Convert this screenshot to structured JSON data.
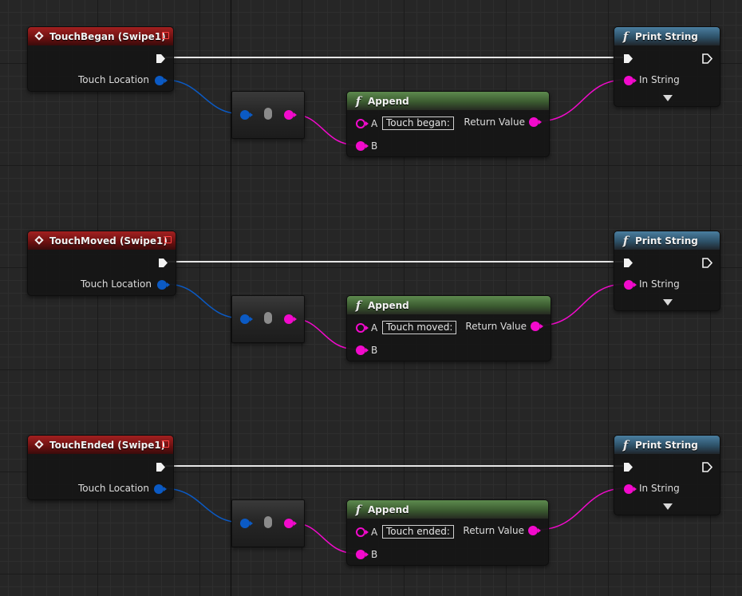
{
  "groups": [
    {
      "event": {
        "title": "TouchBegan (Swipe1)",
        "pin_label": "Touch Location"
      },
      "append": {
        "title": "Append",
        "pin_a": "A",
        "pin_a_value": "Touch began:",
        "pin_b": "B",
        "return_label": "Return Value"
      },
      "print": {
        "title": "Print String",
        "pin_label": "In String"
      }
    },
    {
      "event": {
        "title": "TouchMoved (Swipe1)",
        "pin_label": "Touch Location"
      },
      "append": {
        "title": "Append",
        "pin_a": "A",
        "pin_a_value": "Touch moved:",
        "pin_b": "B",
        "return_label": "Return Value"
      },
      "print": {
        "title": "Print String",
        "pin_label": "In String"
      }
    },
    {
      "event": {
        "title": "TouchEnded (Swipe1)",
        "pin_label": "Touch Location"
      },
      "append": {
        "title": "Append",
        "pin_a": "A",
        "pin_a_value": "Touch ended:",
        "pin_b": "B",
        "return_label": "Return Value"
      },
      "print": {
        "title": "Print String",
        "pin_label": "In String"
      }
    }
  ],
  "icons": {
    "event_node": "event-diamond-icon",
    "function_node": "function-f-icon",
    "close": "close-square-icon",
    "exec_pin": "exec-arrow-icon",
    "vector_pin": "vector-pin-icon",
    "string_pin": "string-pin-icon",
    "expand": "expand-arrow-icon"
  },
  "colors": {
    "event_header": "#a32020",
    "function_header": "#3b5b30",
    "print_header": "#2d5168",
    "vector_wire": "#0b5ac4",
    "string_wire": "#f20acc",
    "exec_wire": "#e6e6e6",
    "grid_background": "#262626"
  }
}
